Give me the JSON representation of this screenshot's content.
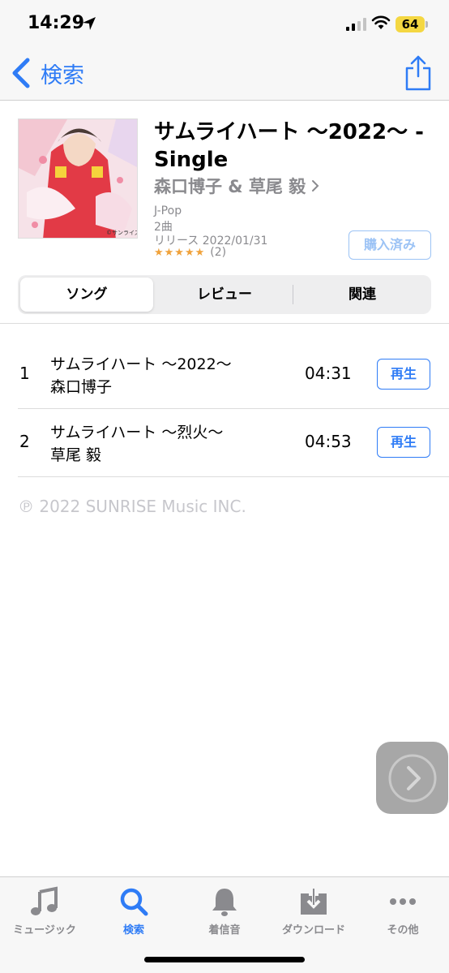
{
  "status_bar": {
    "time": "14:29",
    "battery": "64",
    "icons": [
      "location-arrow-icon",
      "cellular-signal-icon",
      "wifi-icon",
      "battery-icon"
    ]
  },
  "nav": {
    "back_label": "検索",
    "share_icon": "share-icon"
  },
  "album": {
    "title": "サムライハート 〜2022〜 - Single",
    "artist": "森口博子 & 草尾 毅",
    "genre": "J-Pop",
    "track_count": "2曲",
    "release": "リリース 2022/01/31",
    "stars": "★★★★★",
    "rating_count": "(2)",
    "purchased_label": "購入済み",
    "art_credit": "©サンライズ"
  },
  "segments": [
    {
      "label": "ソング",
      "active": true
    },
    {
      "label": "レビュー",
      "active": false
    },
    {
      "label": "関連",
      "active": false
    }
  ],
  "tracks": [
    {
      "number": "1",
      "title": "サムライハート 〜2022〜",
      "artist": "森口博子",
      "duration": "04:31",
      "play_label": "再生"
    },
    {
      "number": "2",
      "title": "サムライハート 〜烈火〜",
      "artist": "草尾 毅",
      "duration": "04:53",
      "play_label": "再生"
    }
  ],
  "copyright": "℗ 2022 SUNRISE Music INC.",
  "tab_bar": {
    "items": [
      {
        "label": "ミュージック",
        "icon": "music-note-icon",
        "active": false
      },
      {
        "label": "検索",
        "icon": "search-icon",
        "active": true
      },
      {
        "label": "着信音",
        "icon": "bell-icon",
        "active": false
      },
      {
        "label": "ダウンロード",
        "icon": "download-icon",
        "active": false
      },
      {
        "label": "その他",
        "icon": "more-icon",
        "active": false
      }
    ]
  },
  "colors": {
    "accent": "#2f7cf6",
    "secondary_text": "#8a8a8e",
    "star": "#f0a23b",
    "battery": "#f4d742"
  }
}
